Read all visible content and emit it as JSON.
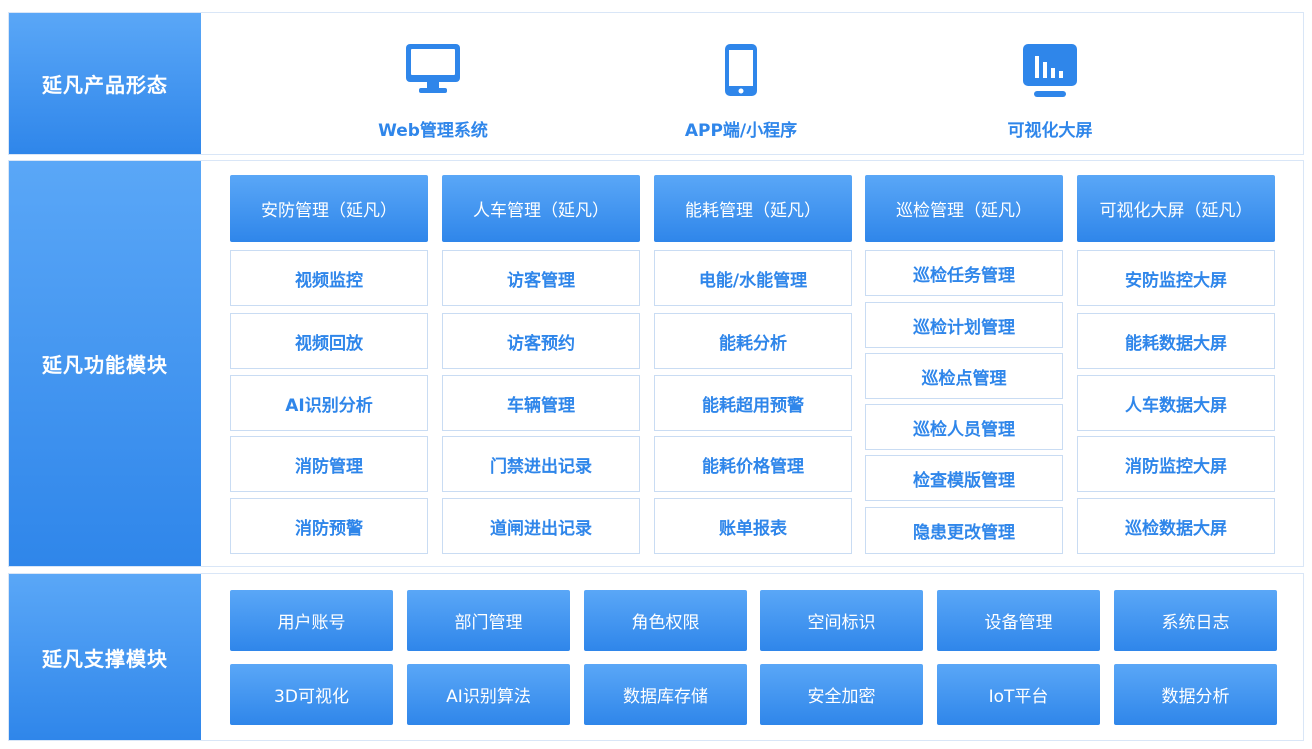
{
  "bands": {
    "forms_label": "延凡产品形态",
    "functions_label": "延凡功能模块",
    "support_label": "延凡支撑模块"
  },
  "forms": [
    {
      "label": "Web管理系统",
      "icon": "monitor-icon"
    },
    {
      "label": "APP端/小程序",
      "icon": "phone-icon"
    },
    {
      "label": "可视化大屏",
      "icon": "dashboard-screen-icon"
    }
  ],
  "modules": [
    {
      "title": "安防管理（延凡）",
      "items": [
        "视频监控",
        "视频回放",
        "AI识别分析",
        "消防管理",
        "消防预警"
      ]
    },
    {
      "title": "人车管理（延凡）",
      "items": [
        "访客管理",
        "访客预约",
        "车辆管理",
        "门禁进出记录",
        "道闸进出记录"
      ]
    },
    {
      "title": "能耗管理（延凡）",
      "items": [
        "电能/水能管理",
        "能耗分析",
        "能耗超用预警",
        "能耗价格管理",
        "账单报表"
      ]
    },
    {
      "title": "巡检管理（延凡）",
      "items": [
        "巡检任务管理",
        "巡检计划管理",
        "巡检点管理",
        "巡检人员管理",
        "检查模版管理",
        "隐患更改管理"
      ]
    },
    {
      "title": "可视化大屏（延凡）",
      "items": [
        "安防监控大屏",
        "能耗数据大屏",
        "人车数据大屏",
        "消防监控大屏",
        "巡检数据大屏"
      ]
    }
  ],
  "support": [
    [
      "用户账号",
      "部门管理",
      "角色权限",
      "空间标识",
      "设备管理",
      "系统日志"
    ],
    [
      "3D可视化",
      "AI识别算法",
      "数据库存储",
      "安全加密",
      "IoT平台",
      "数据分析"
    ]
  ],
  "colors": {
    "accent": "#2f86ea",
    "accent_light": "#5aa7f7",
    "border": "#c9dcf3"
  }
}
